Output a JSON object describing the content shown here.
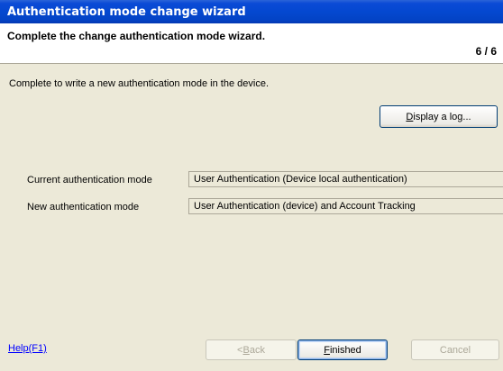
{
  "window": {
    "title": "Authentication mode change wizard"
  },
  "header": {
    "title": "Complete the change authentication mode wizard.",
    "step": "6 / 6"
  },
  "message": "Complete to write a new authentication mode in the device.",
  "log_button": {
    "mnemonic": "D",
    "label_rest": "isplay a log..."
  },
  "fields": {
    "current": {
      "label": "Current authentication mode",
      "value": "User Authentication (Device local authentication)"
    },
    "new": {
      "label": "New authentication mode",
      "value": "User Authentication (device) and Account Tracking"
    }
  },
  "footer": {
    "help_label": "Help(F1)",
    "back": {
      "prefix": "<",
      "mnemonic": "B",
      "label_rest": "ack"
    },
    "finished": {
      "mnemonic": "F",
      "label_rest": "inished"
    },
    "cancel_label": "Cancel"
  }
}
